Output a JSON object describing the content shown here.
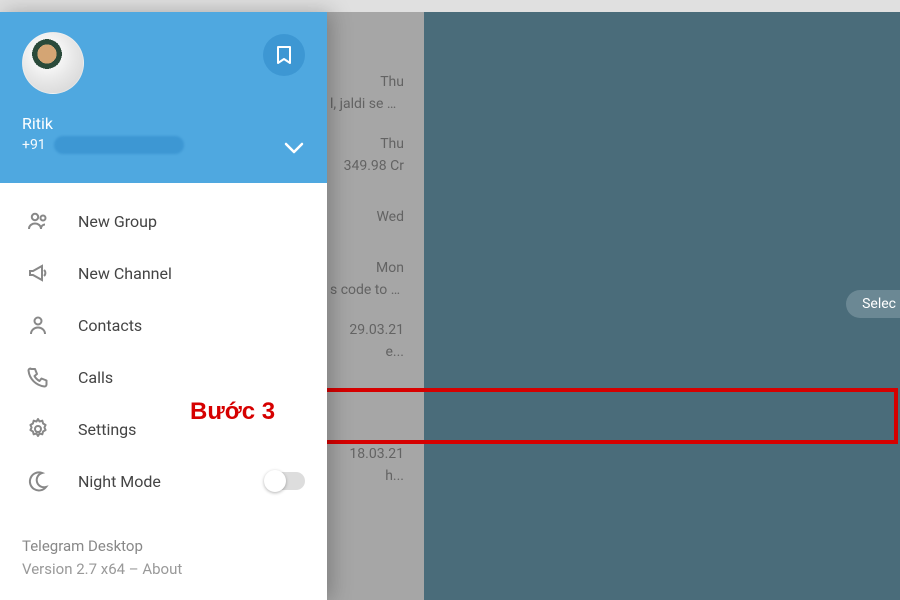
{
  "header": {
    "username": "Ritik",
    "phone_prefix": "+91"
  },
  "menu": {
    "new_group": "New Group",
    "new_channel": "New Channel",
    "contacts": "Contacts",
    "calls": "Calls",
    "settings": "Settings",
    "night_mode": "Night Mode"
  },
  "footer": {
    "app_name": "Telegram Desktop",
    "version_line": "Version 2.7 x64 – About"
  },
  "annotation": {
    "step_label": "Bước 3"
  },
  "chat_list": [
    {
      "timestamp": "Thu",
      "preview": "l, jaldi se d..."
    },
    {
      "timestamp": "Thu",
      "preview": "349.98 Cr"
    },
    {
      "timestamp": "Wed",
      "preview": ""
    },
    {
      "timestamp": "Mon",
      "preview": "s code to a..."
    },
    {
      "timestamp": "29.03.21",
      "preview": "e..."
    },
    {
      "timestamp": "",
      "preview": ""
    },
    {
      "timestamp": "18.03.21",
      "preview": "h..."
    }
  ],
  "right_pane": {
    "select_hint": "Selec"
  }
}
